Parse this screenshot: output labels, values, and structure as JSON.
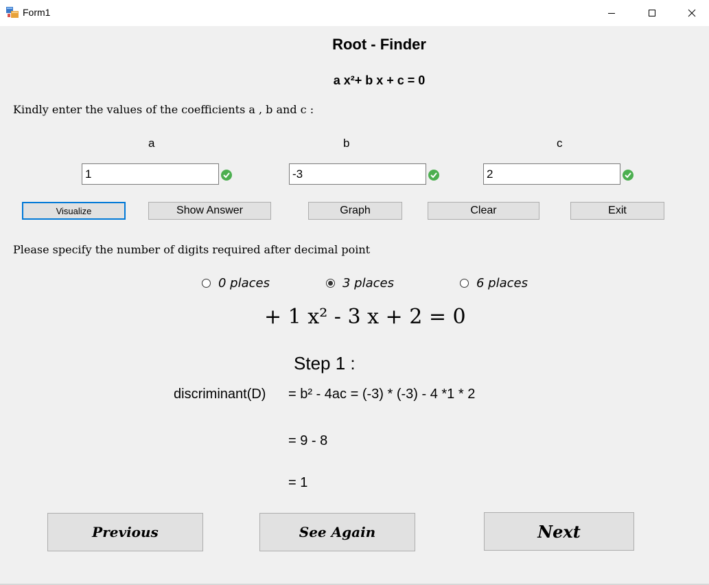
{
  "window": {
    "title": "Form1",
    "icons": [
      "app-icon",
      "minimize-icon",
      "maximize-icon",
      "close-icon"
    ]
  },
  "header": {
    "title": "Root - Finder",
    "equation": "a x²+ b x + c = 0"
  },
  "prompt": "Kindly enter the values of the coefficients a , b and c :",
  "coefficients": {
    "a": {
      "label": "a",
      "value": "1"
    },
    "b": {
      "label": "b",
      "value": "-3"
    },
    "c": {
      "label": "c",
      "value": "2"
    }
  },
  "buttons": {
    "visualize": "Visualize",
    "show_answer": "Show Answer",
    "graph": "Graph",
    "clear": "Clear",
    "exit": "Exit"
  },
  "decimal_prompt": "Please specify the number of digits required after decimal point",
  "decimal_options": [
    {
      "label": "0 places",
      "checked": false
    },
    {
      "label": "3 places",
      "checked": true
    },
    {
      "label": "6 places",
      "checked": false
    }
  ],
  "display_equation": "+ 1 x² - 3 x + 2 = 0",
  "step": {
    "title": "Step 1 :",
    "term": "discriminant(D)",
    "line1": "= b² - 4ac = (-3) * (-3) - 4 *1 * 2",
    "line2": "= 9 - 8",
    "line3": "= 1"
  },
  "nav": {
    "previous": "Previous",
    "see_again": "See Again",
    "next": "Next"
  },
  "colors": {
    "focus_border": "#0078d7",
    "valid_check": "#4caf50",
    "form_background": "#f0f0f0"
  }
}
